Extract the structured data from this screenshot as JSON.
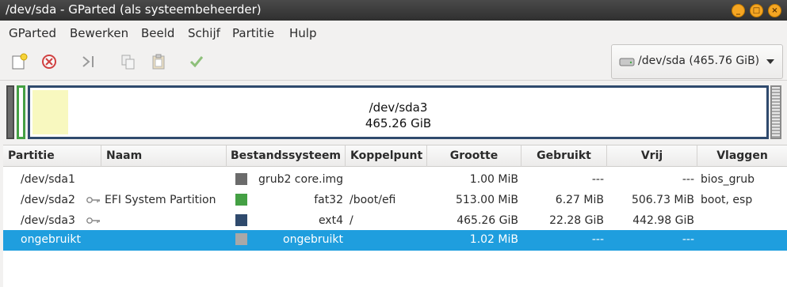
{
  "window": {
    "title": "/dev/sda - GParted (als systeembeheerder)"
  },
  "menu": [
    "GParted",
    "Bewerken",
    "Beeld",
    "Schijf",
    "Partitie",
    "Hulp"
  ],
  "toolbar": {
    "icons": [
      "new-partition-icon",
      "delete-partition-icon",
      "resize-move-icon",
      "copy-icon",
      "paste-icon",
      "apply-icon"
    ],
    "device_selector": "/dev/sda (465.76 GiB)"
  },
  "disk_graphic": {
    "main_partition_name": "/dev/sda3",
    "main_partition_size": "465.26 GiB",
    "used_fraction_of_main": 0.048
  },
  "table": {
    "columns": [
      "Partitie",
      "Naam",
      "Bestandssysteem",
      "Koppelpunt",
      "Grootte",
      "Gebruikt",
      "Vrij",
      "Vlaggen"
    ],
    "rows": [
      {
        "partition": "/dev/sda1",
        "name": "",
        "fs": "grub2 core.img",
        "fs_color": "#6b6b6b",
        "mount": "",
        "size": "1.00 MiB",
        "used": "---",
        "free": "---",
        "flags": "bios_grub",
        "selected": false,
        "has_key": false
      },
      {
        "partition": "/dev/sda2",
        "name": "EFI System Partition",
        "fs": "fat32",
        "fs_color": "#44a044",
        "mount": "/boot/efi",
        "size": "513.00 MiB",
        "used": "6.27 MiB",
        "free": "506.73 MiB",
        "flags": "boot, esp",
        "selected": false,
        "has_key": true
      },
      {
        "partition": "/dev/sda3",
        "name": "",
        "fs": "ext4",
        "fs_color": "#2f4a6d",
        "mount": "/",
        "size": "465.26 GiB",
        "used": "22.28 GiB",
        "free": "442.98 GiB",
        "flags": "",
        "selected": false,
        "has_key": true
      },
      {
        "partition": "ongebruikt",
        "name": "",
        "fs": "ongebruikt",
        "fs_color": "#a8a8a8",
        "mount": "",
        "size": "1.02 MiB",
        "used": "---",
        "free": "---",
        "flags": "",
        "selected": true,
        "has_key": false
      }
    ]
  },
  "colors": {
    "selection": "#1f9ede",
    "window_buttons": "#f5a623"
  }
}
